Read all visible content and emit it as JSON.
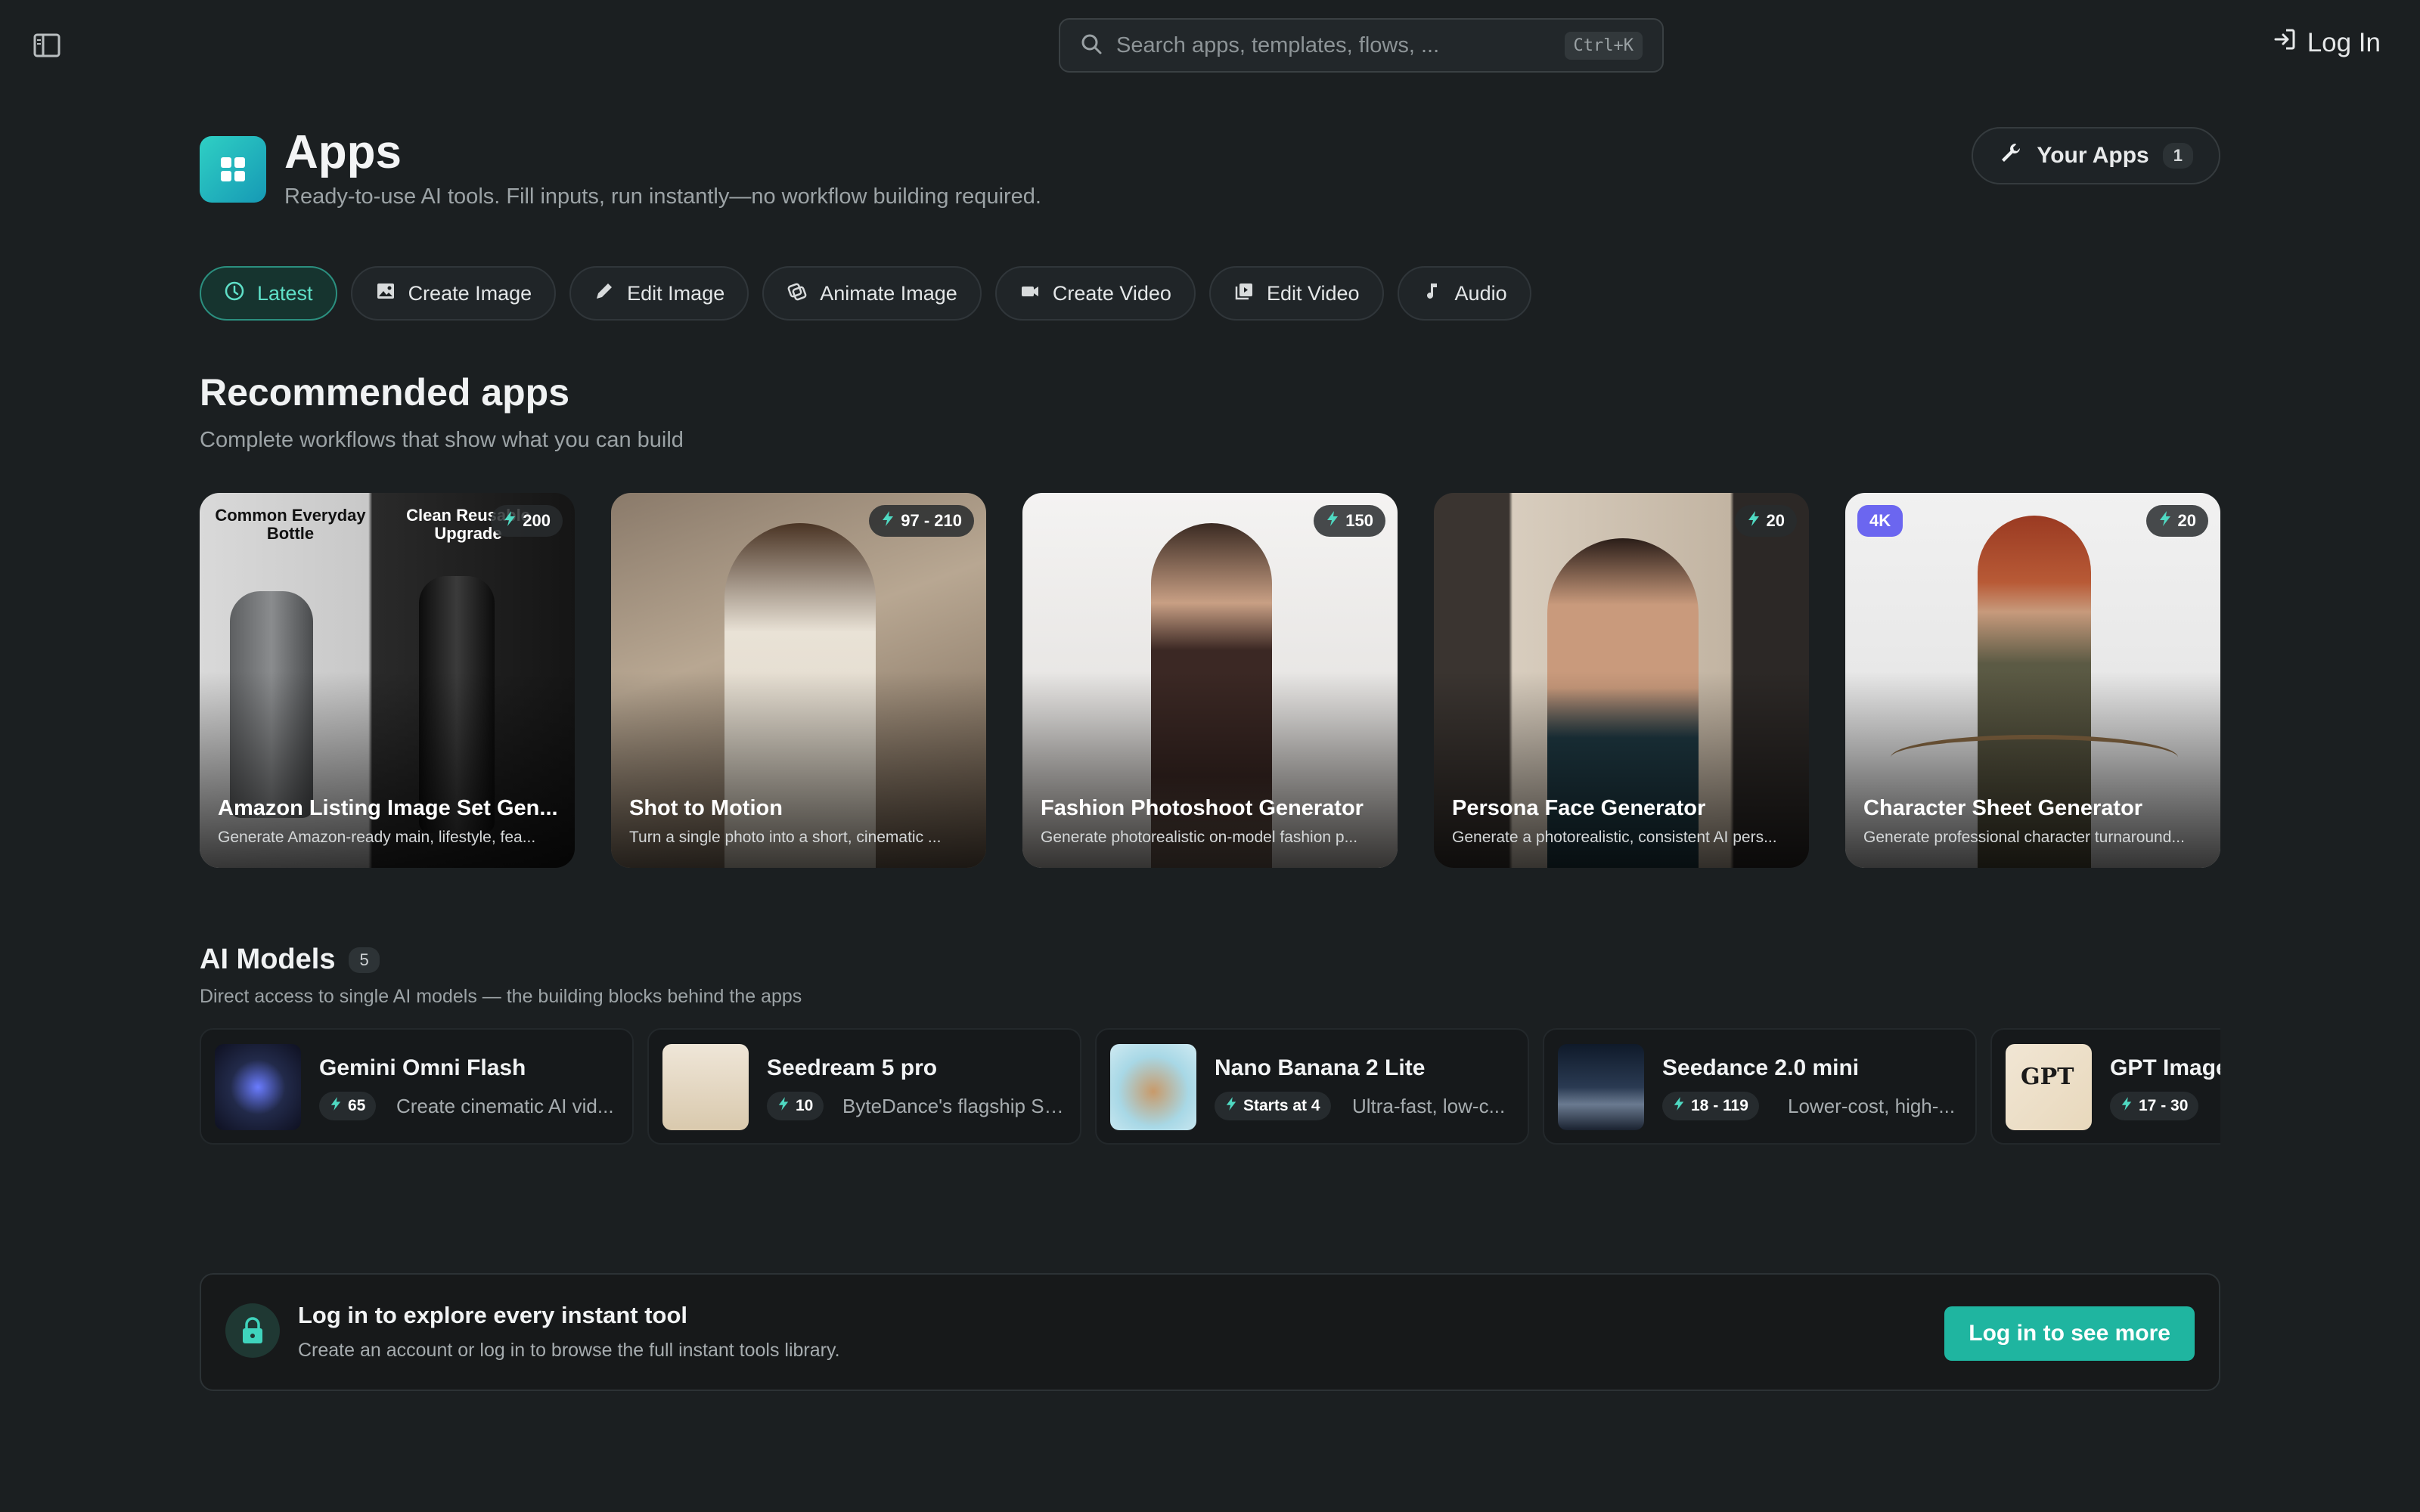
{
  "topbar": {
    "search_placeholder": "Search apps, templates, flows, ...",
    "search_shortcut": "Ctrl+K",
    "login_label": "Log In"
  },
  "header": {
    "title": "Apps",
    "subtitle": "Ready-to-use AI tools. Fill inputs, run instantly—no workflow building required.",
    "your_apps_label": "Your Apps",
    "your_apps_count": "1"
  },
  "tabs": [
    {
      "label": "Latest",
      "icon": "clock-icon",
      "active": true
    },
    {
      "label": "Create Image",
      "icon": "image-icon",
      "active": false
    },
    {
      "label": "Edit Image",
      "icon": "pencil-icon",
      "active": false
    },
    {
      "label": "Animate Image",
      "icon": "animate-icon",
      "active": false
    },
    {
      "label": "Create Video",
      "icon": "video-camera-icon",
      "active": false
    },
    {
      "label": "Edit Video",
      "icon": "video-edit-icon",
      "active": false
    },
    {
      "label": "Audio",
      "icon": "music-note-icon",
      "active": false
    }
  ],
  "recommended": {
    "title": "Recommended apps",
    "subtitle": "Complete workflows that show what you can build",
    "cards": [
      {
        "title": "Amazon Listing Image Set Gen...",
        "desc": "Generate Amazon-ready main, lifestyle, fea...",
        "cost": "200",
        "overlay_left": "Common Everyday Bottle",
        "overlay_right": "Clean Reusable Upgrade"
      },
      {
        "title": "Shot to Motion",
        "desc": "Turn a single photo into a short, cinematic ...",
        "cost": "97 - 210"
      },
      {
        "title": "Fashion Photoshoot Generator",
        "desc": "Generate photorealistic on-model fashion p...",
        "cost": "150"
      },
      {
        "title": "Persona Face Generator",
        "desc": "Generate a photorealistic, consistent AI pers...",
        "cost": "20"
      },
      {
        "title": "Character Sheet Generator",
        "desc": "Generate professional character turnaround...",
        "cost": "20",
        "badge": "4K"
      }
    ]
  },
  "models": {
    "title": "AI Models",
    "count": "5",
    "subtitle": "Direct access to single AI models — the building blocks behind the apps",
    "items": [
      {
        "name": "Gemini Omni Flash",
        "cost": "65",
        "desc": "Create cinematic AI vid..."
      },
      {
        "name": "Seedream 5 pro",
        "cost": "10",
        "desc": "ByteDance's flagship Se..."
      },
      {
        "name": "Nano Banana 2 Lite",
        "cost": "Starts at 4",
        "desc": "Ultra-fast, low-c..."
      },
      {
        "name": "Seedance 2.0 mini",
        "cost": "18 - 119",
        "desc": "Lower-cost, high-..."
      },
      {
        "name": "GPT Image",
        "cost": "17 - 30",
        "desc": ""
      }
    ]
  },
  "cta": {
    "title": "Log in to explore every instant tool",
    "subtitle": "Create an account or log in to browse the full instant tools library.",
    "button": "Log in to see more"
  },
  "colors": {
    "background": "#1b1f21",
    "accent": "#1fb5a0",
    "active_tab_text": "#5fe0c8",
    "badge_4k": "#6b66f0"
  }
}
